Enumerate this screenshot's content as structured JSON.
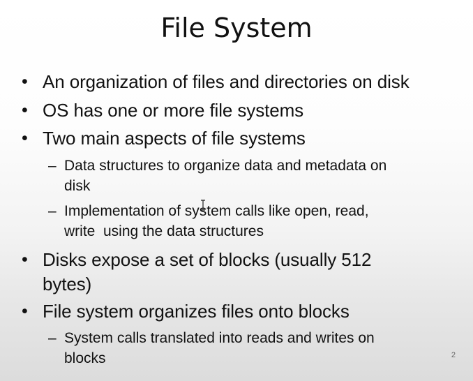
{
  "slide": {
    "title": "File System",
    "page_number": "2",
    "bullets": [
      {
        "text": "An organization of files and directories on disk"
      },
      {
        "text": "OS has one or more file systems"
      },
      {
        "text": "Two main aspects of file systems",
        "subs": [
          {
            "line1": "Data structures to organize data and metadata on",
            "line2": "disk"
          },
          {
            "line1": "Implementation of system calls like open, read,",
            "line2": "write  using the data structures"
          }
        ]
      },
      {
        "line1": "Disks expose a set of blocks (usually 512",
        "line2": "bytes)"
      },
      {
        "text": "File system organizes files onto blocks",
        "subs": [
          {
            "line1": "System calls translated into reads and writes on",
            "line2": "blocks"
          }
        ]
      }
    ]
  }
}
